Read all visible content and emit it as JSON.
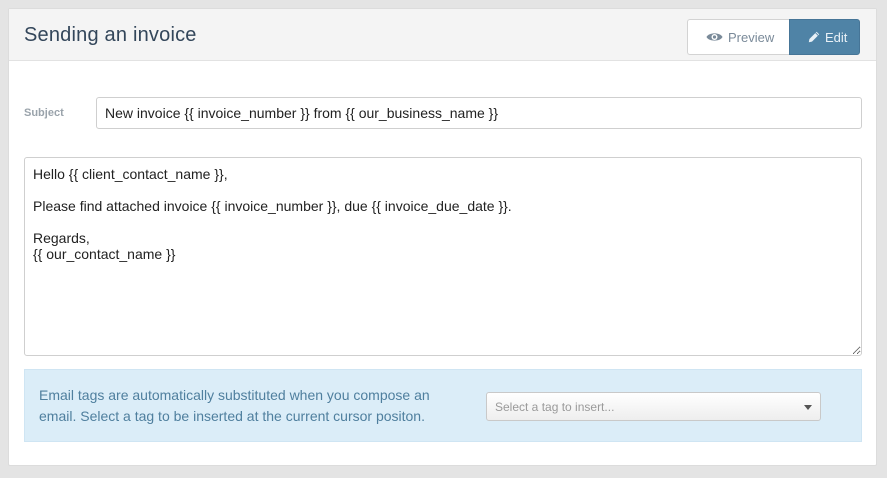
{
  "header": {
    "title": "Sending an invoice",
    "preview_label": "Preview",
    "edit_label": "Edit",
    "active_tab": "Edit"
  },
  "form": {
    "subject_label": "Subject",
    "subject_value": "New invoice {{ invoice_number }} from {{ our_business_name }}",
    "body_value": "Hello {{ client_contact_name }},\n\nPlease find attached invoice {{ invoice_number }}, due {{ invoice_due_date }}.\n\nRegards,\n{{ our_contact_name }}"
  },
  "tags_help": {
    "text": "Email tags are automatically substituted when you compose an email. Select a tag to be inserted at the current cursor positon.",
    "select_placeholder": "Select a tag to insert..."
  },
  "icons": {
    "preview": "eye-icon",
    "edit": "pencil-icon",
    "dropdown": "chevron-down-icon"
  },
  "colors": {
    "edit_button_bg": "#4f83a6",
    "info_bg": "#dbedf8",
    "info_text": "#4f7f9e",
    "title_text": "#33465a"
  }
}
